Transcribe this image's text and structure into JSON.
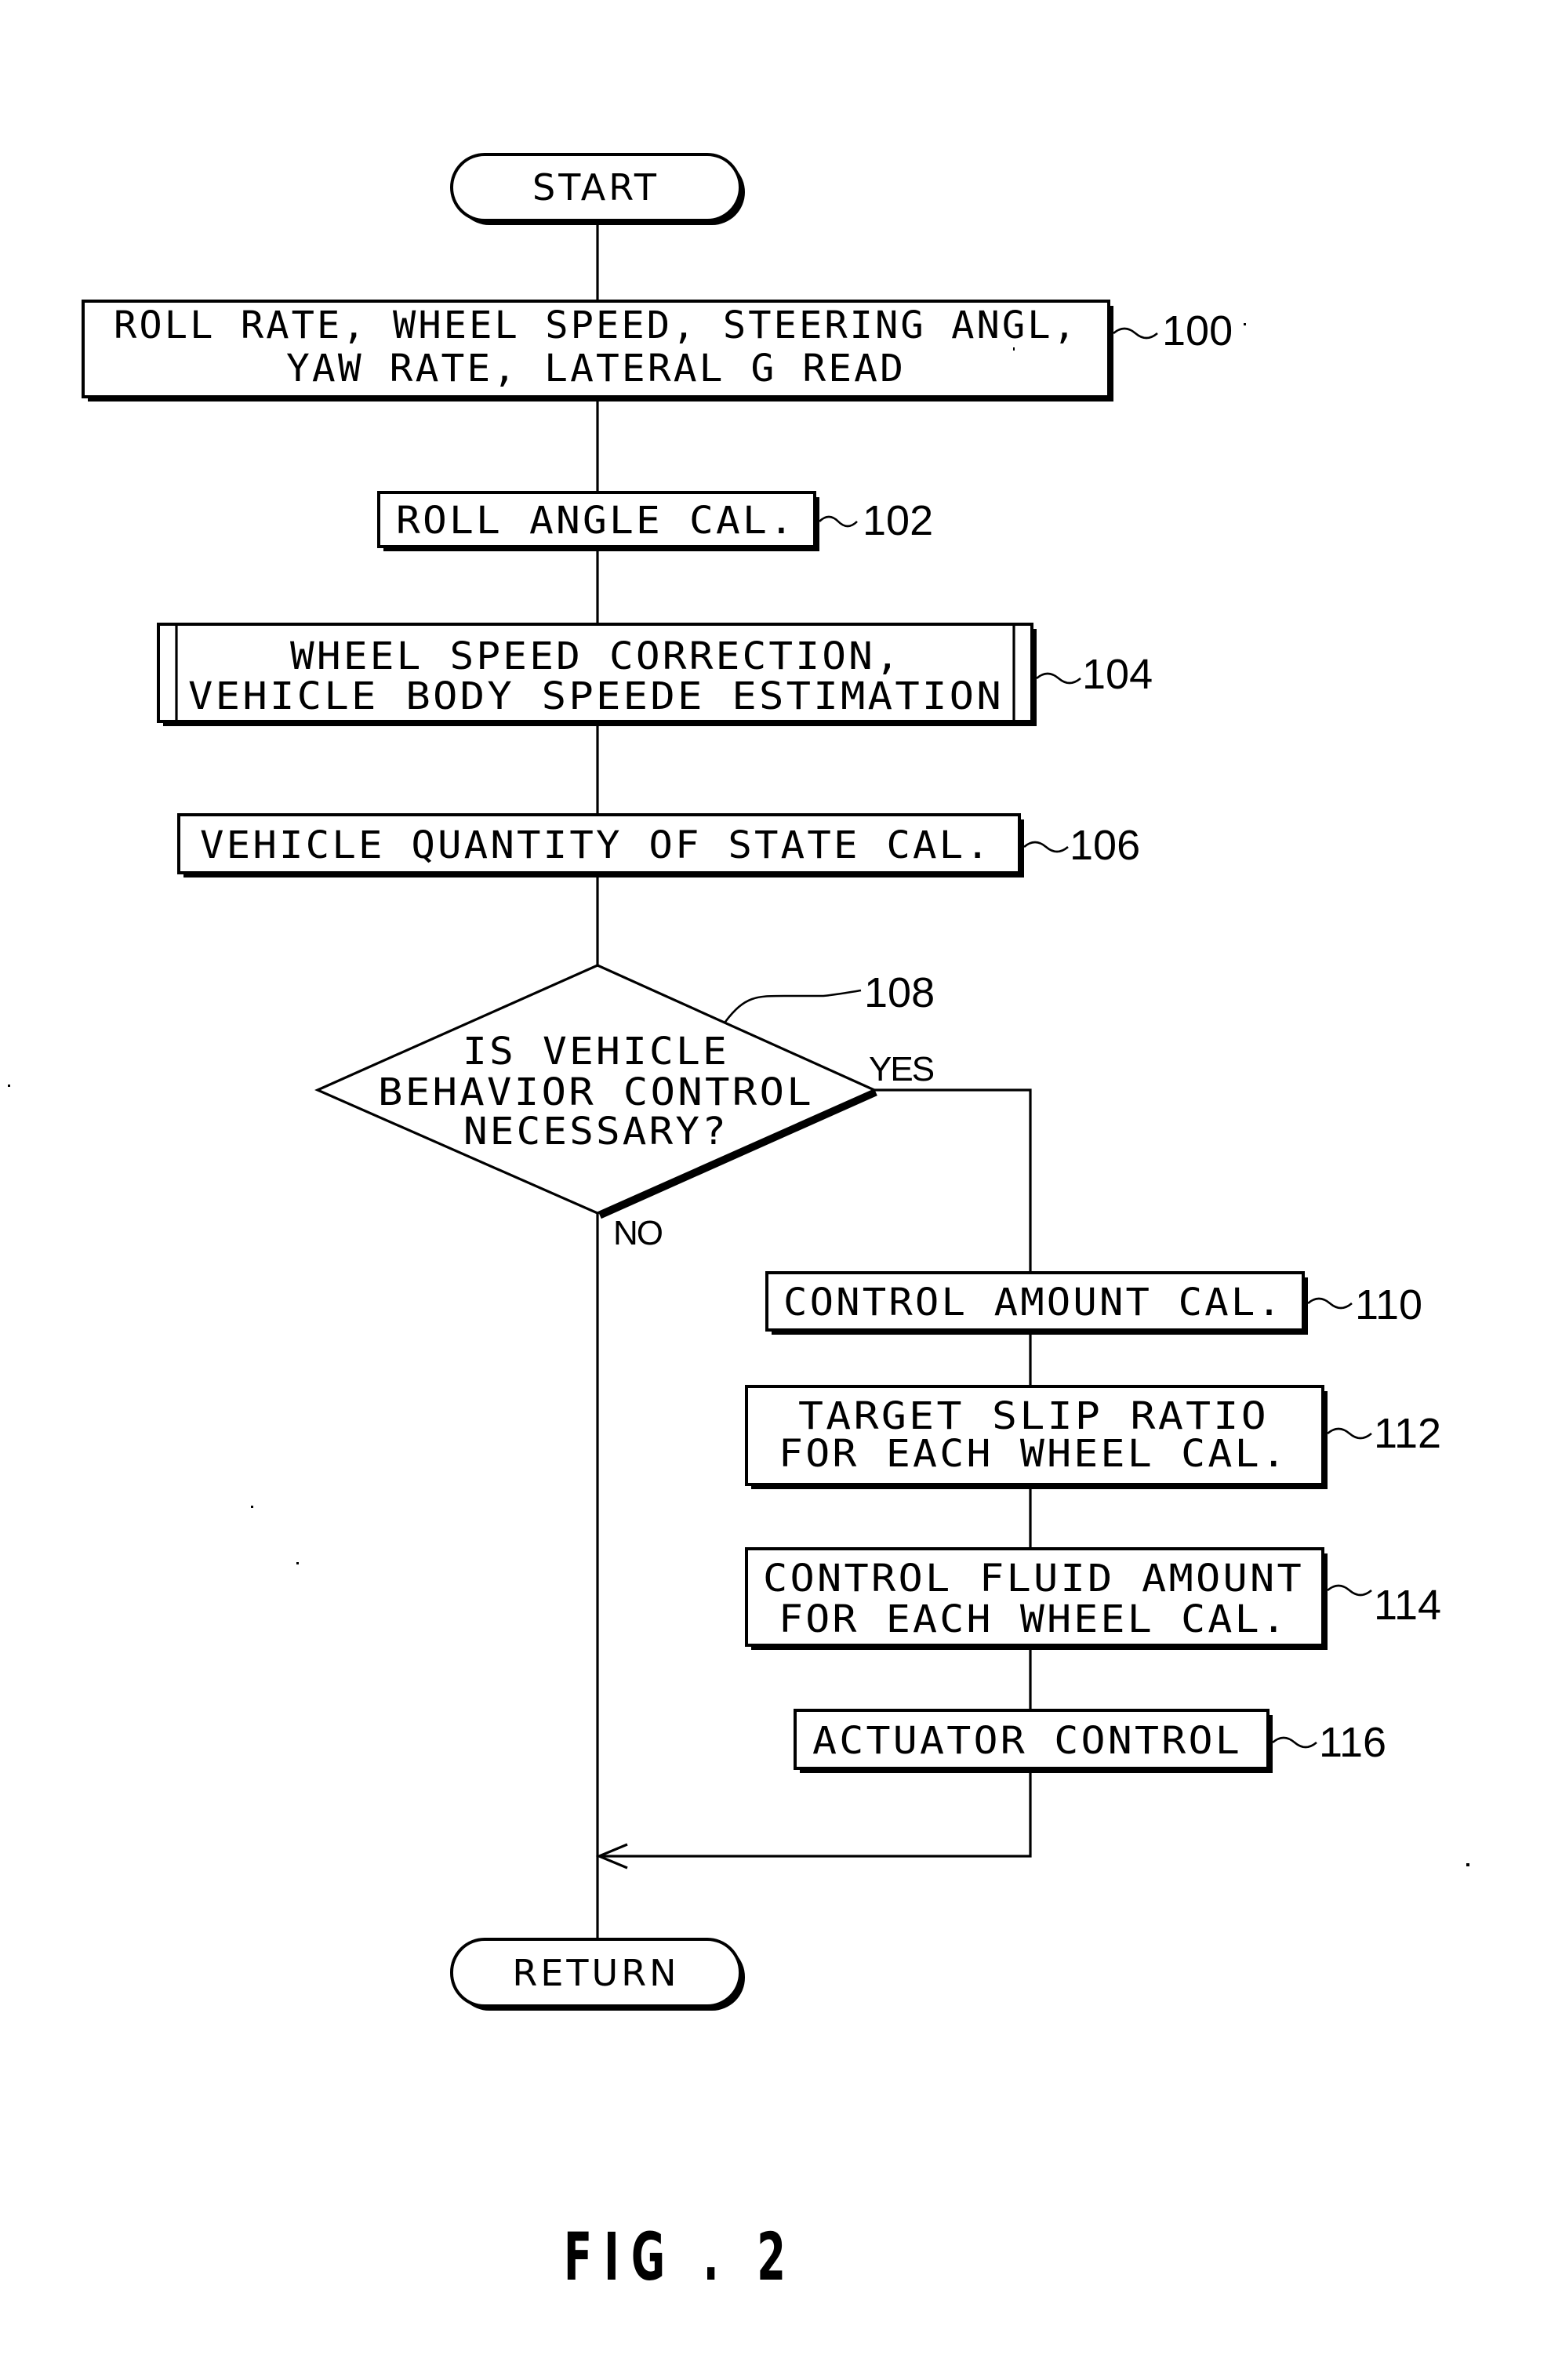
{
  "figure": {
    "caption": "FIG . 2",
    "type": "flowchart"
  },
  "terminals": {
    "start": "START",
    "end": "RETURN"
  },
  "steps": [
    {
      "ref": "100",
      "lines": [
        "ROLL RATE, WHEEL SPEED, STEERING ANGL,",
        "YAW RATE, LATERAL G READ"
      ]
    },
    {
      "ref": "102",
      "lines": [
        "ROLL ANGLE CAL."
      ]
    },
    {
      "ref": "104",
      "lines": [
        "WHEEL SPEED CORRECTION,",
        "VEHICLE BODY SPEEDE ESTIMATION"
      ],
      "kind": "predefined-process"
    },
    {
      "ref": "106",
      "lines": [
        "VEHICLE QUANTITY OF STATE CAL."
      ]
    },
    {
      "ref": "110",
      "lines": [
        "CONTROL AMOUNT CAL."
      ]
    },
    {
      "ref": "112",
      "lines": [
        "TARGET SLIP RATIO",
        "FOR EACH WHEEL CAL."
      ]
    },
    {
      "ref": "114",
      "lines": [
        "CONTROL FLUID AMOUNT",
        "FOR EACH WHEEL CAL."
      ]
    },
    {
      "ref": "116",
      "lines": [
        "ACTUATOR CONTROL"
      ]
    }
  ],
  "decision": {
    "ref": "108",
    "lines": [
      "IS VEHICLE",
      "BEHAVIOR CONTROL",
      "NECESSARY?"
    ],
    "yes_label": "YES",
    "no_label": "NO"
  },
  "colors": {
    "ink": "#000000",
    "paper": "#ffffff"
  }
}
